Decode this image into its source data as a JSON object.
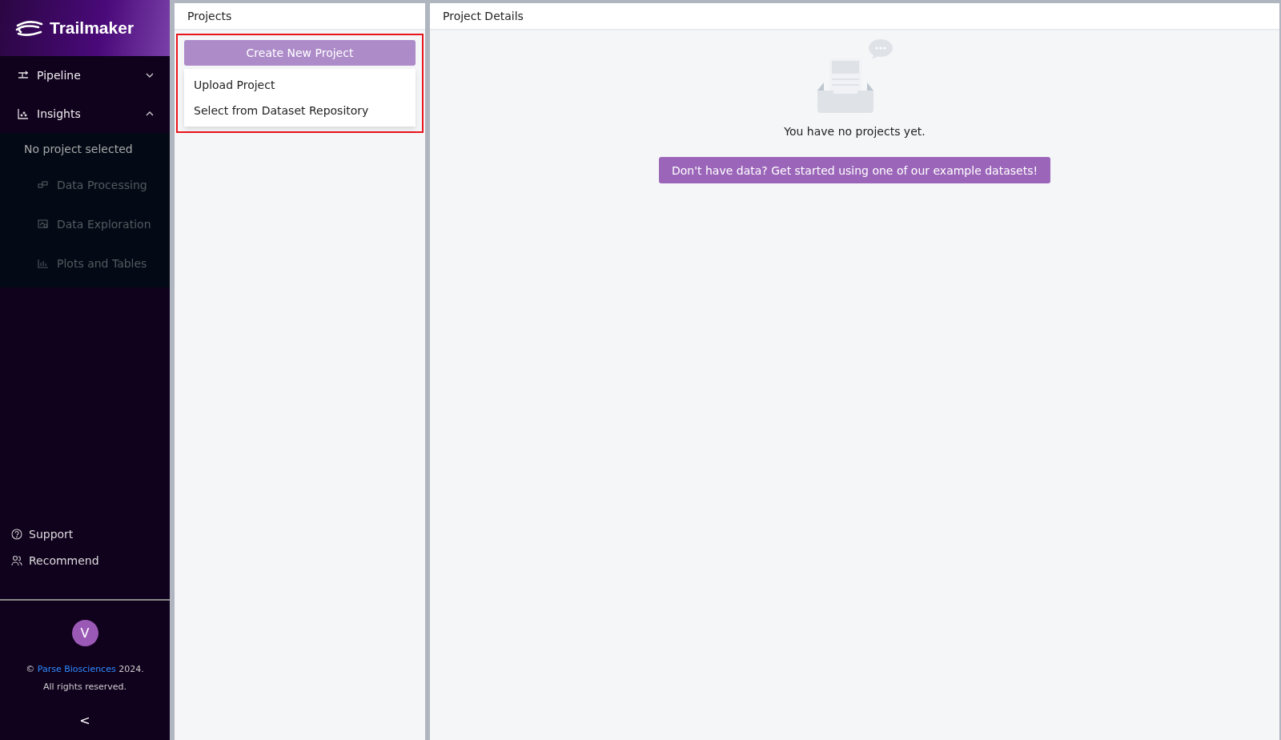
{
  "sidebar": {
    "logo": "Trailmaker",
    "nav": [
      {
        "label": "Pipeline",
        "expanded": false
      },
      {
        "label": "Insights",
        "expanded": true
      }
    ],
    "insights_note": "No project selected",
    "insights_items": [
      {
        "label": "Data Processing",
        "disabled": true
      },
      {
        "label": "Data Exploration",
        "disabled": true
      },
      {
        "label": "Plots and Tables",
        "disabled": true
      }
    ],
    "links": [
      {
        "label": "Support"
      },
      {
        "label": "Recommend"
      }
    ],
    "avatar": "V",
    "copyright": {
      "symbol": "©",
      "link": "Parse Biosciences",
      "year": "2024.",
      "rights": "All rights reserved."
    },
    "collapse": "<"
  },
  "projects": {
    "title": "Projects",
    "highlighted": true,
    "create_button": "Create New Project",
    "menu": [
      {
        "label": "Upload Project"
      },
      {
        "label": "Select from Dataset Repository"
      }
    ]
  },
  "details": {
    "title": "Project Details",
    "empty_text": "You have no projects yet.",
    "example_button": "Don't have data? Get started using one of our example datasets!"
  }
}
